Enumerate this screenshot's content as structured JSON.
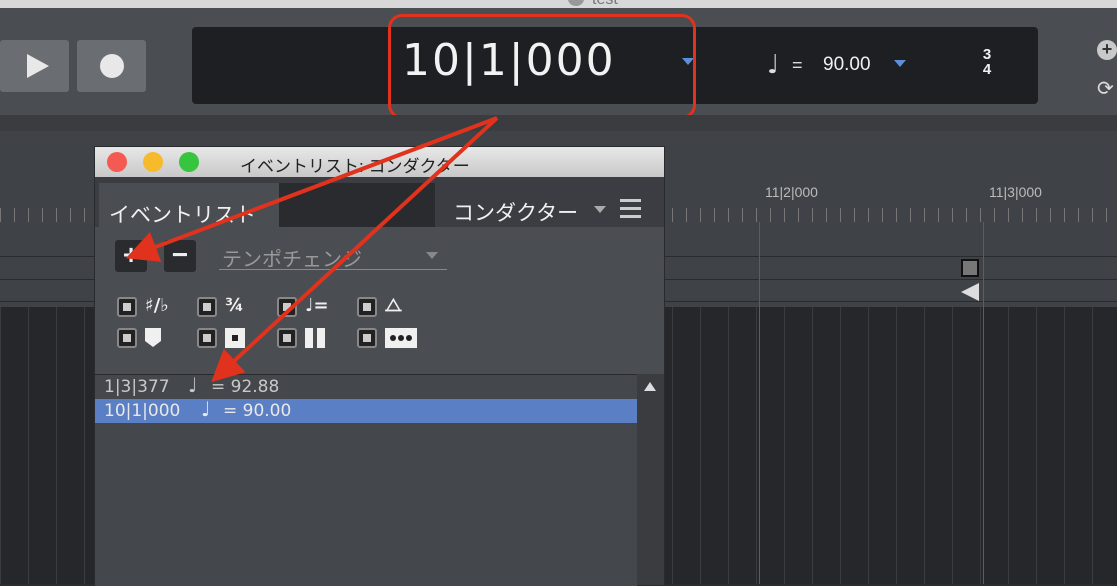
{
  "window": {
    "title": "test"
  },
  "transport": {
    "position": "10|1|000",
    "tempo_note": "♩",
    "tempo_equals": "=",
    "tempo_value": "90.00",
    "time_sig_top": "3",
    "time_sig_bottom": "4"
  },
  "ruler": {
    "labels": [
      "11|2|000",
      "11|3|000"
    ]
  },
  "panel": {
    "title": "イベントリスト: コンダクター",
    "tab_label": "イベントリスト",
    "target_label": "コンダクター",
    "add_label": "+",
    "remove_label": "−",
    "event_type": "テンポチェンジ",
    "filter_icons": [
      "key-signature-icon",
      "time-signature-icon",
      "tempo-icon",
      "metronome-icon",
      "marker-icon",
      "cue-icon",
      "pause-icon",
      "dots-icon"
    ]
  },
  "events": [
    {
      "pos": "1|3|377",
      "note": "♩",
      "value": "= 92.88"
    },
    {
      "pos": "10|1|000",
      "note": "♩",
      "value": "= 90.00"
    }
  ],
  "colors": {
    "highlight": "#e0321c",
    "selection": "#5b7fc4",
    "accent": "#5b8fd6"
  }
}
